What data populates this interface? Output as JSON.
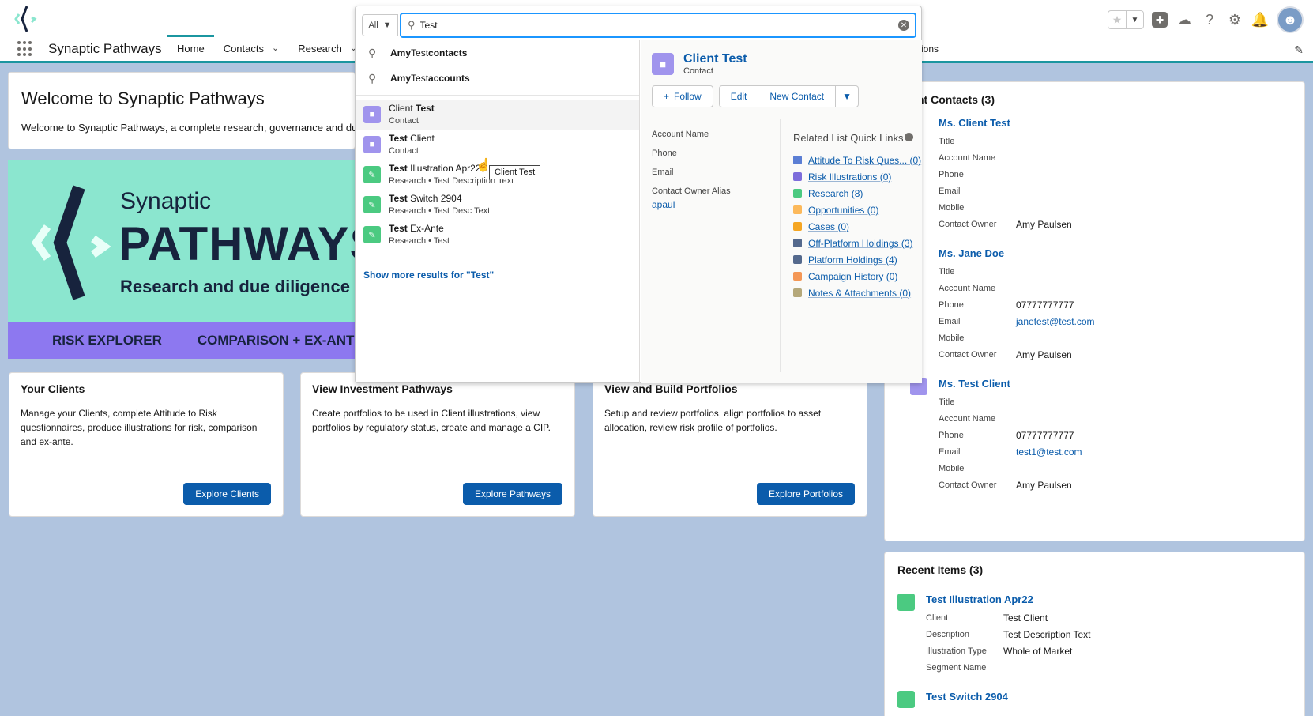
{
  "header": {
    "app_name": "Synaptic Pathways",
    "nav": [
      {
        "label": "Home"
      },
      {
        "label": "Contacts"
      },
      {
        "label": "Research"
      }
    ],
    "nav_tail": "ions"
  },
  "welcome": {
    "title": "Welcome to Synaptic Pathways",
    "text": "Welcome to Synaptic Pathways, a complete research, governance and due di"
  },
  "banner": {
    "synaptic": "Synaptic",
    "pathways": "PATHWAYS",
    "tagline": "Research and due diligence s",
    "bottom": [
      "RISK EXPLORER",
      "COMPARISON + EX-ANT"
    ]
  },
  "tiles": [
    {
      "title": "Your Clients",
      "text": "Manage your Clients, complete Attitude to Risk questionnaires, produce illustrations for risk, comparison and ex-ante.",
      "button": "Explore Clients"
    },
    {
      "title": "View Investment Pathways",
      "text": "Create portfolios to be used in Client illustrations, view portfolios by regulatory status, create and manage a CIP.",
      "button": "Explore Pathways"
    },
    {
      "title": "View and Build Portfolios",
      "text": "Setup and review portfolios, align portfolios to asset allocation, review risk profile of portfolios.",
      "button": "Explore Portfolios"
    }
  ],
  "contacts_card": {
    "title": "nt Contacts (3)",
    "items": [
      {
        "name": "Ms. Client Test",
        "rows": [
          [
            "Title",
            ""
          ],
          [
            "Account Name",
            ""
          ],
          [
            "Phone",
            ""
          ],
          [
            "Email",
            ""
          ],
          [
            "Mobile",
            ""
          ],
          [
            "Contact Owner",
            "Amy Paulsen"
          ]
        ]
      },
      {
        "name": "Ms. Jane Doe",
        "rows": [
          [
            "Title",
            ""
          ],
          [
            "Account Name",
            ""
          ],
          [
            "Phone",
            "07777777777"
          ],
          [
            "Email",
            "janetest@test.com"
          ],
          [
            "Mobile",
            ""
          ],
          [
            "Contact Owner",
            "Amy Paulsen"
          ]
        ]
      },
      {
        "name": "Ms. Test Client",
        "rows": [
          [
            "Title",
            ""
          ],
          [
            "Account Name",
            ""
          ],
          [
            "Phone",
            "07777777777"
          ],
          [
            "Email",
            "test1@test.com"
          ],
          [
            "Mobile",
            ""
          ],
          [
            "Contact Owner",
            "Amy Paulsen"
          ]
        ]
      }
    ]
  },
  "recent_card": {
    "title": "Recent Items (3)",
    "items": [
      {
        "name": "Test Illustration Apr22",
        "rows": [
          [
            "Client",
            "Test Client"
          ],
          [
            "Description",
            "Test Description Text"
          ],
          [
            "Illustration Type",
            "Whole of Market"
          ],
          [
            "Segment Name",
            ""
          ]
        ]
      },
      {
        "name": "Test Switch 2904",
        "rows": []
      }
    ]
  },
  "search": {
    "scope": "All",
    "query": "Test",
    "suggestions": [
      {
        "pre": "Amy ",
        "mid": "Test",
        "post": " contacts"
      },
      {
        "pre": "Amy ",
        "mid": "Test",
        "post": " accounts"
      }
    ],
    "results": [
      {
        "type": "contact",
        "title_pre": "Client ",
        "title_bold": "Test",
        "title_post": "",
        "sub": "Contact"
      },
      {
        "type": "contact",
        "title_pre": "",
        "title_bold": "Test",
        "title_post": " Client",
        "sub": "Contact"
      },
      {
        "type": "research",
        "title_pre": "",
        "title_bold": "Test",
        "title_post": " Illustration Apr22",
        "sub": "Research • Test Description Text"
      },
      {
        "type": "research",
        "title_pre": "",
        "title_bold": "Test",
        "title_post": " Switch 2904",
        "sub": "Research • Test Desc Text"
      },
      {
        "type": "research",
        "title_pre": "",
        "title_bold": "Test",
        "title_post": " Ex-Ante",
        "sub": "Research • Test"
      }
    ],
    "show_more": "Show more results for \"Test\"",
    "tooltip": "Client Test",
    "preview": {
      "name": "Client Test",
      "type": "Contact",
      "follow": "Follow",
      "edit": "Edit",
      "new_contact": "New Contact",
      "fields": [
        "Account Name",
        "Phone",
        "Email",
        "Contact Owner Alias"
      ],
      "owner_alias": "apaul",
      "quick_title": "Related List Quick Links",
      "quick_links": [
        {
          "label": "Attitude To Risk Ques... (0)",
          "color": "#5b7ed4"
        },
        {
          "label": "Risk Illustrations (0)",
          "color": "#7d6ddb"
        },
        {
          "label": "Research (8)",
          "color": "#4bca81"
        },
        {
          "label": "Opportunities (0)",
          "color": "#fcb95b"
        },
        {
          "label": "Cases (0)",
          "color": "#f5a623"
        },
        {
          "label": "Off-Platform Holdings (3)",
          "color": "#54698d"
        },
        {
          "label": "Platform Holdings (4)",
          "color": "#54698d"
        },
        {
          "label": "Campaign History (0)",
          "color": "#f49756"
        },
        {
          "label": "Notes & Attachments (0)",
          "color": "#b5a87a"
        }
      ]
    }
  }
}
